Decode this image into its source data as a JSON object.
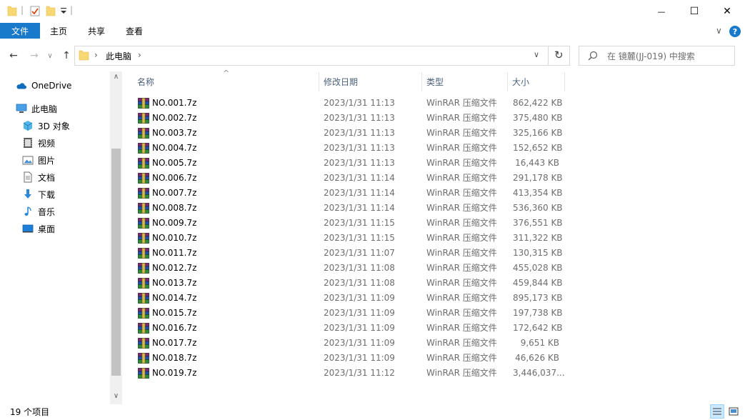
{
  "titlebar": {
    "qat_separator": "|",
    "minimize_glyph": "—",
    "maximize_glyph": "☐",
    "close_glyph": "✕"
  },
  "ribbon": {
    "file_tab": "文件",
    "tabs": [
      "主页",
      "共享",
      "查看"
    ],
    "expand_glyph": "∨",
    "help_glyph": "?"
  },
  "address": {
    "back_glyph": "←",
    "forward_glyph": "→",
    "recent_glyph": "∨",
    "up_glyph": "↑",
    "crumb_sep": "›",
    "location": "此电脑",
    "trail_sep": "›",
    "dropdown_glyph": "∨",
    "refresh_glyph": "↻"
  },
  "search": {
    "placeholder": "在 镜麓(JJ-019) 中搜索"
  },
  "nav": {
    "items": [
      {
        "label": "OneDrive",
        "icon": "cloud-icon"
      },
      {
        "label": "此电脑",
        "icon": "computer-icon"
      },
      {
        "label": "3D 对象",
        "icon": "3d-objects-icon"
      },
      {
        "label": "视频",
        "icon": "video-icon"
      },
      {
        "label": "图片",
        "icon": "pictures-icon"
      },
      {
        "label": "文档",
        "icon": "documents-icon"
      },
      {
        "label": "下载",
        "icon": "download-icon"
      },
      {
        "label": "音乐",
        "icon": "music-icon"
      },
      {
        "label": "桌面",
        "icon": "desktop-icon"
      }
    ],
    "scroll_up_glyph": "∧",
    "scroll_down_glyph": "∨"
  },
  "columns": {
    "name": "名称",
    "date": "修改日期",
    "type": "类型",
    "size": "大小",
    "sort_glyph": "^"
  },
  "files": [
    {
      "name": "NO.001.7z",
      "date": "2023/1/31 11:13",
      "type": "WinRAR 压缩文件",
      "size": "862,422 KB"
    },
    {
      "name": "NO.002.7z",
      "date": "2023/1/31 11:13",
      "type": "WinRAR 压缩文件",
      "size": "375,480 KB"
    },
    {
      "name": "NO.003.7z",
      "date": "2023/1/31 11:13",
      "type": "WinRAR 压缩文件",
      "size": "325,166 KB"
    },
    {
      "name": "NO.004.7z",
      "date": "2023/1/31 11:13",
      "type": "WinRAR 压缩文件",
      "size": "152,652 KB"
    },
    {
      "name": "NO.005.7z",
      "date": "2023/1/31 11:13",
      "type": "WinRAR 压缩文件",
      "size": "16,443 KB"
    },
    {
      "name": "NO.006.7z",
      "date": "2023/1/31 11:14",
      "type": "WinRAR 压缩文件",
      "size": "291,178 KB"
    },
    {
      "name": "NO.007.7z",
      "date": "2023/1/31 11:14",
      "type": "WinRAR 压缩文件",
      "size": "413,354 KB"
    },
    {
      "name": "NO.008.7z",
      "date": "2023/1/31 11:14",
      "type": "WinRAR 压缩文件",
      "size": "536,360 KB"
    },
    {
      "name": "NO.009.7z",
      "date": "2023/1/31 11:15",
      "type": "WinRAR 压缩文件",
      "size": "376,551 KB"
    },
    {
      "name": "NO.010.7z",
      "date": "2023/1/31 11:15",
      "type": "WinRAR 压缩文件",
      "size": "311,322 KB"
    },
    {
      "name": "NO.011.7z",
      "date": "2023/1/31 11:07",
      "type": "WinRAR 压缩文件",
      "size": "130,315 KB"
    },
    {
      "name": "NO.012.7z",
      "date": "2023/1/31 11:08",
      "type": "WinRAR 压缩文件",
      "size": "455,028 KB"
    },
    {
      "name": "NO.013.7z",
      "date": "2023/1/31 11:08",
      "type": "WinRAR 压缩文件",
      "size": "459,844 KB"
    },
    {
      "name": "NO.014.7z",
      "date": "2023/1/31 11:09",
      "type": "WinRAR 压缩文件",
      "size": "895,173 KB"
    },
    {
      "name": "NO.015.7z",
      "date": "2023/1/31 11:09",
      "type": "WinRAR 压缩文件",
      "size": "197,738 KB"
    },
    {
      "name": "NO.016.7z",
      "date": "2023/1/31 11:09",
      "type": "WinRAR 压缩文件",
      "size": "172,642 KB"
    },
    {
      "name": "NO.017.7z",
      "date": "2023/1/31 11:09",
      "type": "WinRAR 压缩文件",
      "size": "9,651 KB"
    },
    {
      "name": "NO.018.7z",
      "date": "2023/1/31 11:09",
      "type": "WinRAR 压缩文件",
      "size": "46,626 KB"
    },
    {
      "name": "NO.019.7z",
      "date": "2023/1/31 11:12",
      "type": "WinRAR 压缩文件",
      "size": "3,446,037..."
    }
  ],
  "status": {
    "item_count": "19 个项目"
  },
  "colors": {
    "accent": "#1979ca",
    "folder": "#f8d775",
    "header_text": "#4c607a",
    "secondary_text": "#6d6d6d"
  }
}
